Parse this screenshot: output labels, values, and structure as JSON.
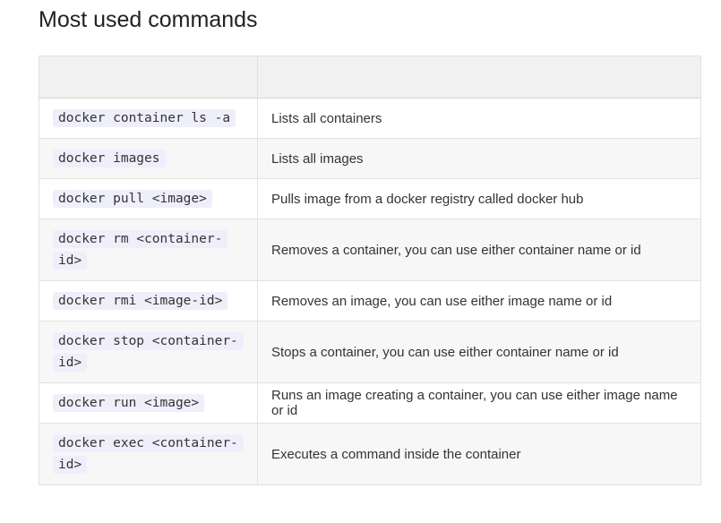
{
  "title": "Most used commands",
  "table": {
    "headers": [
      "",
      ""
    ],
    "rows": [
      {
        "command": "docker container ls -a",
        "description": "Lists all containers"
      },
      {
        "command": "docker images",
        "description": "Lists all images"
      },
      {
        "command": "docker pull <image>",
        "description": "Pulls image from a docker registry called docker hub"
      },
      {
        "command": "docker rm <container-id>",
        "description": "Removes a container, you can use either container name or id"
      },
      {
        "command": "docker rmi <image-id>",
        "description": "Removes an image, you can use either image name or id"
      },
      {
        "command": "docker stop <container-id>",
        "description": "Stops a container, you can use either container name or id"
      },
      {
        "command": "docker run <image>",
        "description": "Runs an image creating a container, you can use either image name or id"
      },
      {
        "command": "docker exec <container-id>",
        "description": "Executes a command inside the container"
      }
    ]
  }
}
